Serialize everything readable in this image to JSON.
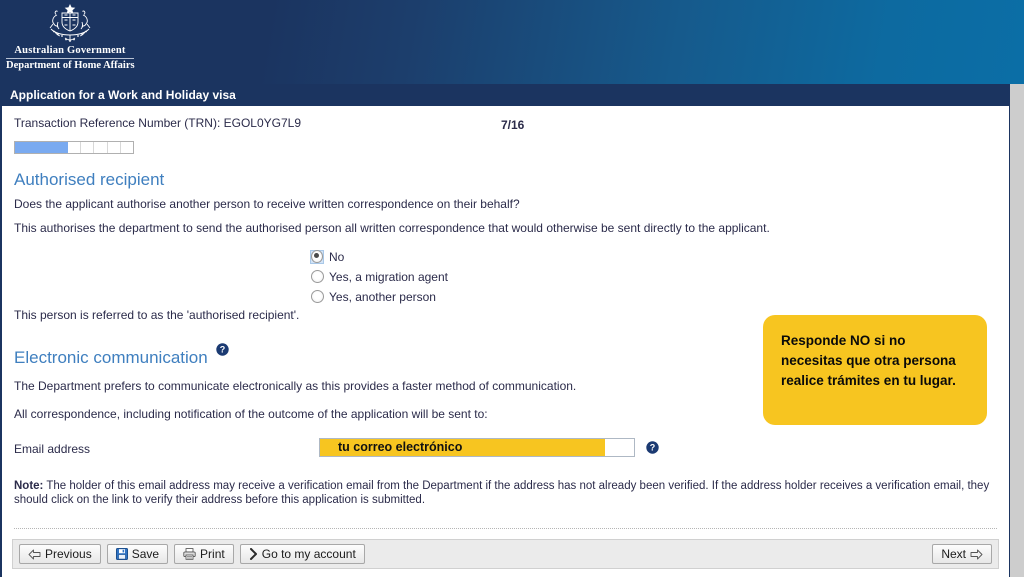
{
  "header": {
    "crest_alt": "australian-coat-of-arms",
    "org_line1": "Australian Government",
    "org_line2": "Department of Home Affairs",
    "gradient_from": "#1b3460",
    "gradient_to": "#0b6ea6"
  },
  "title_bar": {
    "title": "Application for a Work and Holiday visa",
    "background": "#1b3460"
  },
  "progress": {
    "trn_label": "Transaction Reference Number (TRN): EGOL0YG7L9",
    "page_counter": "7/16",
    "filled_percent": 45,
    "segments": 6,
    "fill_color": "#7aaaf0"
  },
  "authorised_recipient": {
    "heading": "Authorised recipient",
    "question": "Does the applicant authorise another person to receive written correspondence on their behalf?",
    "description": "This authorises the department to send the authorised person all written correspondence that would otherwise be sent directly to the applicant.",
    "options": [
      {
        "label": "No",
        "checked": true
      },
      {
        "label": "Yes, a migration agent",
        "checked": false
      },
      {
        "label": "Yes, another person",
        "checked": false
      }
    ],
    "footnote": "This person is referred to as the 'authorised recipient'."
  },
  "callout": {
    "text": "Responde NO si no necesitas que otra persona realice trámites en tu lugar.",
    "background": "#f7c520",
    "text_color": "#0a0a0a"
  },
  "electronic_communication": {
    "heading": "Electronic communication",
    "help_icon": "help-icon",
    "paragraph1": "The Department prefers to communicate electronically as this provides a faster method of communication.",
    "paragraph2": "All correspondence, including notification of the outcome of the application will be sent to:",
    "email_label": "Email address",
    "email_value": "tu correo electrónico",
    "email_highlight_color": "#f7c520",
    "note_prefix": "Note:",
    "note_text": " The holder of this email address may receive a verification email from the Department if the address has not already been verified. If the address holder receives a verification email, they should click on the link to verify their address before this application is submitted."
  },
  "toolbar": {
    "previous_label": "Previous",
    "previous_icon": "arrow-left-icon",
    "save_label": "Save",
    "save_icon": "floppy-disk-icon",
    "print_label": "Print",
    "print_icon": "printer-icon",
    "account_label": "Go to my account",
    "account_icon": "chevron-right-icon",
    "next_label": "Next",
    "next_icon": "arrow-right-icon"
  }
}
